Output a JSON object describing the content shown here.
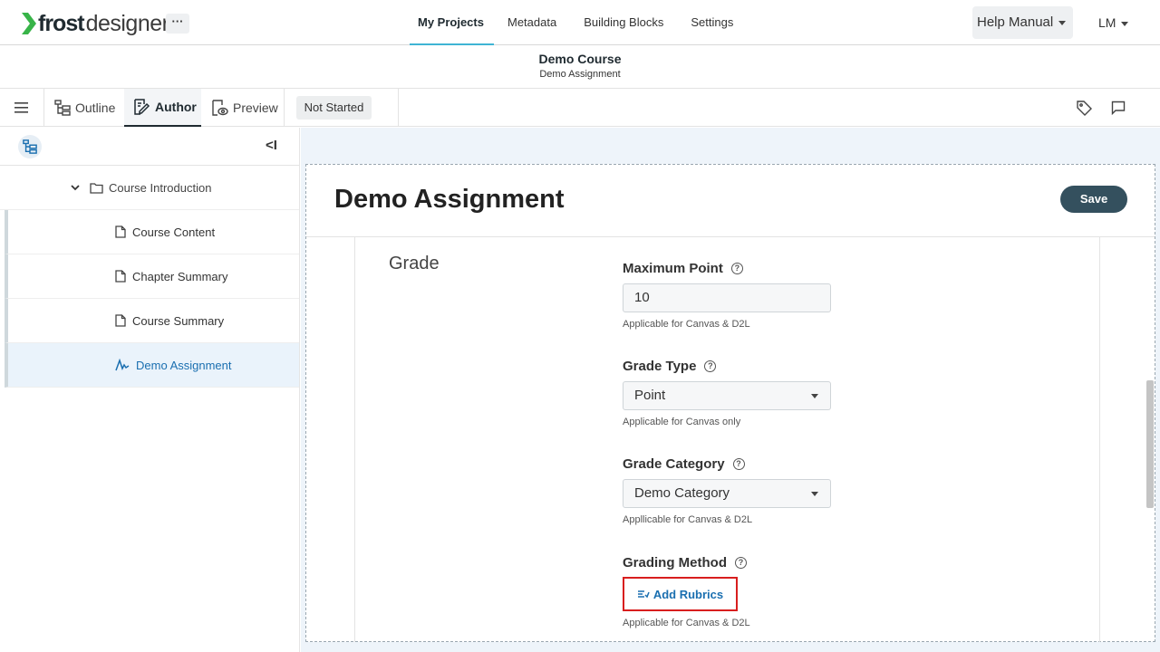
{
  "brand": {
    "name_bold": "frost",
    "name_light": "designer",
    "more_label": "···"
  },
  "nav": {
    "tabs": [
      {
        "label": "My Projects",
        "active": true
      },
      {
        "label": "Metadata",
        "active": false
      },
      {
        "label": "Building Blocks",
        "active": false
      },
      {
        "label": "Settings",
        "active": false
      }
    ],
    "help_label": "Help Manual",
    "user_initials": "LM"
  },
  "course": {
    "title": "Demo Course",
    "subtitle": "Demo Assignment"
  },
  "toolbar": {
    "outline_label": "Outline",
    "author_label": "Author",
    "preview_label": "Preview",
    "status": "Not Started"
  },
  "sidebar": {
    "collapse_label": "<I",
    "folder": "Course Introduction",
    "items": [
      {
        "label": "Course Content",
        "icon": "page-icon",
        "active": false
      },
      {
        "label": "Chapter Summary",
        "icon": "page-icon",
        "active": false
      },
      {
        "label": "Course Summary",
        "icon": "page-icon",
        "active": false
      },
      {
        "label": "Demo Assignment",
        "icon": "assignment-icon",
        "active": true
      }
    ]
  },
  "editor": {
    "title": "Demo Assignment",
    "save_label": "Save",
    "section": "Grade",
    "fields": {
      "max_point": {
        "label": "Maximum Point",
        "value": "10",
        "hint": "Applicable for Canvas & D2L"
      },
      "grade_type": {
        "label": "Grade Type",
        "value": "Point",
        "hint": "Applicable for Canvas only"
      },
      "grade_category": {
        "label": "Grade Category",
        "value": "Demo Category",
        "hint": "Appllicable for Canvas & D2L"
      },
      "grading_method": {
        "label": "Grading Method",
        "button": "Add Rubrics",
        "hint": "Applicable for Canvas & D2L"
      }
    }
  },
  "colors": {
    "accent": "#3fb4d4",
    "save_bg": "#34505e",
    "link": "#1a6fb0",
    "highlight_border": "#d81e1e"
  }
}
